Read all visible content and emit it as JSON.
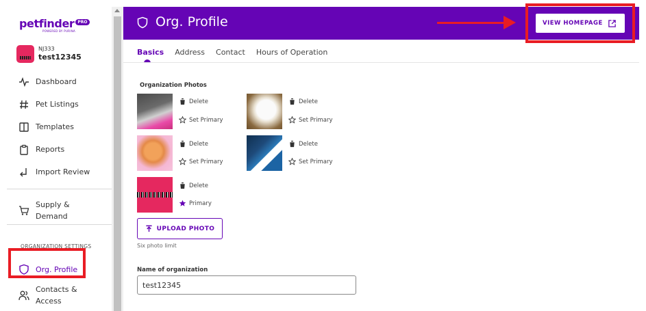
{
  "brand": {
    "name": "petfinder",
    "badge": "PRO",
    "sub": "POWERED BY PURINA"
  },
  "org": {
    "code": "NJ333",
    "name": "test12345"
  },
  "nav": {
    "main": [
      {
        "label": "Dashboard",
        "icon": "pulse-icon"
      },
      {
        "label": "Pet Listings",
        "icon": "hash-icon"
      },
      {
        "label": "Templates",
        "icon": "columns-icon"
      },
      {
        "label": "Reports",
        "icon": "clipboard-icon"
      },
      {
        "label": "Import Review",
        "icon": "import-arrow-icon"
      }
    ],
    "supply": {
      "line1": "Supply &",
      "line2": "Demand"
    },
    "section_title": "ORGANIZATION SETTINGS",
    "org_profile": "Org. Profile",
    "contacts": {
      "line1": "Contacts &",
      "line2": "Access"
    }
  },
  "header": {
    "title": "Org. Profile",
    "homepage_button": "VIEW HOMEPAGE"
  },
  "tabs": [
    "Basics",
    "Address",
    "Contact",
    "Hours of Operation"
  ],
  "photos": {
    "label": "Organization Photos",
    "delete": "Delete",
    "set_primary": "Set Primary",
    "primary": "Primary",
    "upload": "UPLOAD PHOTO",
    "limit": "Six photo limit"
  },
  "form": {
    "name_label": "Name of organization",
    "name_value": "test12345"
  },
  "colors": {
    "brand_purple": "#6504b5",
    "annotation_red": "#e91c24"
  }
}
